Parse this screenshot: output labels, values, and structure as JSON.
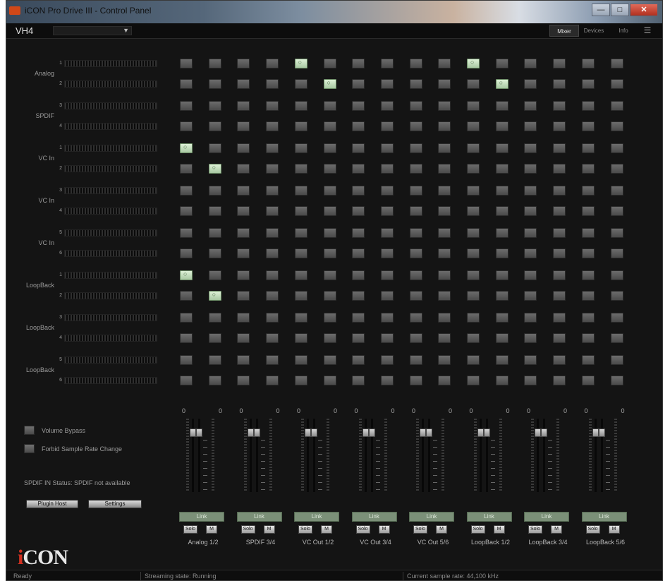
{
  "window": {
    "title": "iCON Pro Drive III - Control Panel",
    "buttons": [
      "—",
      "□",
      "✕"
    ]
  },
  "device": {
    "name": "VH4"
  },
  "tabs": [
    {
      "label": "Mixer",
      "active": true
    },
    {
      "label": "Devices",
      "active": false
    },
    {
      "label": "Info",
      "active": false
    },
    {
      "label": "☰",
      "active": false
    }
  ],
  "inputs": [
    {
      "group": "Analog",
      "numbers": [
        "1",
        "2"
      ]
    },
    {
      "group": "SPDIF",
      "numbers": [
        "3",
        "4"
      ]
    },
    {
      "group": "VC In",
      "numbers": [
        "1",
        "2"
      ]
    },
    {
      "group": "VC In",
      "numbers": [
        "3",
        "4"
      ]
    },
    {
      "group": "VC In",
      "numbers": [
        "5",
        "6"
      ]
    },
    {
      "group": "LoopBack",
      "numbers": [
        "1",
        "2"
      ]
    },
    {
      "group": "LoopBack",
      "numbers": [
        "3",
        "4"
      ]
    },
    {
      "group": "LoopBack",
      "numbers": [
        "5",
        "6"
      ]
    }
  ],
  "matrix_active": [
    [
      0,
      4
    ],
    [
      0,
      10
    ],
    [
      1,
      5
    ],
    [
      1,
      11
    ],
    [
      4,
      0
    ],
    [
      5,
      1
    ],
    [
      10,
      0
    ],
    [
      11,
      1
    ]
  ],
  "outputs": [
    {
      "label": "Analog 1/2",
      "left_value": "0",
      "right_value": "0",
      "link": "Link",
      "solo": "Solo",
      "mute": "M"
    },
    {
      "label": "SPDIF 3/4",
      "left_value": "0",
      "right_value": "0",
      "link": "Link",
      "solo": "Solo",
      "mute": "M"
    },
    {
      "label": "VC Out 1/2",
      "left_value": "0",
      "right_value": "0",
      "link": "Link",
      "solo": "Solo",
      "mute": "M"
    },
    {
      "label": "VC Out 3/4",
      "left_value": "0",
      "right_value": "0",
      "link": "Link",
      "solo": "Solo",
      "mute": "M"
    },
    {
      "label": "VC Out 5/6",
      "left_value": "0",
      "right_value": "0",
      "link": "Link",
      "solo": "Solo",
      "mute": "M"
    },
    {
      "label": "LoopBack 1/2",
      "left_value": "0",
      "right_value": "0",
      "link": "Link",
      "solo": "Solo",
      "mute": "M"
    },
    {
      "label": "LoopBack 3/4",
      "left_value": "0",
      "right_value": "0",
      "link": "Link",
      "solo": "Solo",
      "mute": "M"
    },
    {
      "label": "LoopBack 5/6",
      "left_value": "0",
      "right_value": "0",
      "link": "Link",
      "solo": "Solo",
      "mute": "M"
    }
  ],
  "options": {
    "volume_bypass": "Volume Bypass",
    "forbid_sample_rate": "Forbid Sample Rate Change",
    "spdif_status": "SPDIF IN Status: SPDIF not available",
    "plugin_host": "Plugin Host",
    "settings": "Settings"
  },
  "logo": {
    "text_i": "i",
    "text_rest": "CON"
  },
  "status": {
    "ready": "Ready",
    "streaming": "Streaming state: Running",
    "sample_rate": "Current sample rate: 44,100 kHz"
  },
  "colors": {
    "accent_on": "#c8e6c0",
    "logo_i": "#d03020",
    "link": "#7b9078"
  }
}
